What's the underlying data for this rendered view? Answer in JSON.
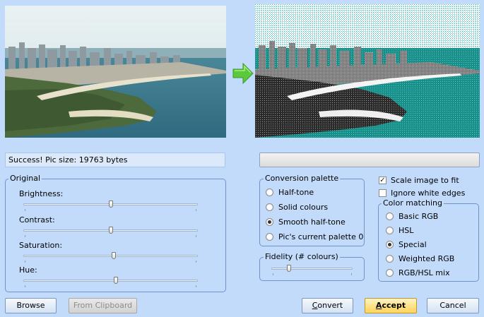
{
  "status": {
    "text": "Success! Pic size: 19763 bytes",
    "progress_fraction": 0.0
  },
  "images": {
    "original_name": "original-photo",
    "converted_name": "converted-photo",
    "arrow_icon": "green-arrow-right-icon"
  },
  "original": {
    "title": "Original",
    "sliders": [
      {
        "label": "Brightness:",
        "value": 0.5
      },
      {
        "label": "Contrast:",
        "value": 0.5
      },
      {
        "label": "Saturation:",
        "value": 0.52
      },
      {
        "label": "Hue:",
        "value": 0.53
      }
    ]
  },
  "conversion_palette": {
    "title": "Conversion palette",
    "options": [
      "Half-tone",
      "Solid colours",
      "Smooth half-tone",
      "Pic's current palette 0"
    ],
    "selected": "Smooth half-tone"
  },
  "fidelity": {
    "title": "Fidelity (# colours)",
    "value": 0.22
  },
  "checkboxes": [
    {
      "label": "Scale image to fit",
      "checked": true
    },
    {
      "label": "Ignore white edges",
      "checked": false
    }
  ],
  "color_matching": {
    "title": "Color matching",
    "options": [
      "Basic RGB",
      "HSL",
      "Special",
      "Weighted RGB",
      "RGB/HSL mix"
    ],
    "selected": "Special"
  },
  "buttons": {
    "browse": "Browse",
    "clipboard": "From Clipboard",
    "convert_pre": "",
    "convert_u": "C",
    "convert_post": "onvert",
    "accept_pre": "",
    "accept_u": "A",
    "accept_post": "ccept",
    "cancel": "Cancel"
  },
  "colors": {
    "background": "#c3dbfa",
    "accent": "#ffd55b",
    "arrow": "#5cc83c"
  }
}
